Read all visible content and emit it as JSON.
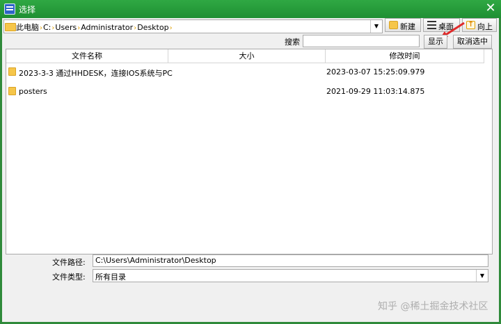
{
  "window": {
    "title": "选择",
    "close_glyph": "✕",
    "icon": "window-app-icon"
  },
  "address": {
    "crumbs": [
      "此电脑",
      "C:",
      "Users",
      "Administrator",
      "Desktop"
    ],
    "separator": "›",
    "dropdown_glyph": "▼"
  },
  "toolbar": {
    "new_label": "新建",
    "desktop_label": "桌面",
    "up_label": "向上"
  },
  "search": {
    "label": "搜索",
    "value": "",
    "show_label": "显示",
    "deselect_label": "取消选中"
  },
  "list": {
    "columns": [
      "文件名称",
      "大小",
      "修改时间"
    ],
    "rows": [
      {
        "name": "2023-3-3 通过HHDESK，连接IOS系统与PC",
        "size": "",
        "modified": "2023-03-07 15:25:09.979",
        "icon": "folder-icon"
      },
      {
        "name": "posters",
        "size": "",
        "modified": "2021-09-29 11:03:14.875",
        "icon": "folder-icon"
      }
    ]
  },
  "footer": {
    "path_label": "文件路径:",
    "path_value": "C:\\Users\\Administrator\\Desktop",
    "type_label": "文件类型:",
    "type_value": "所有目录",
    "type_dropdown_glyph": "▼",
    "watermark": "知乎 @稀土掘金技术社区"
  },
  "colors": {
    "title_bar": "#1f8f33",
    "window_frame": "#2f8a3a",
    "arrow": "#e02a2a",
    "folder": "#f6c64a"
  }
}
